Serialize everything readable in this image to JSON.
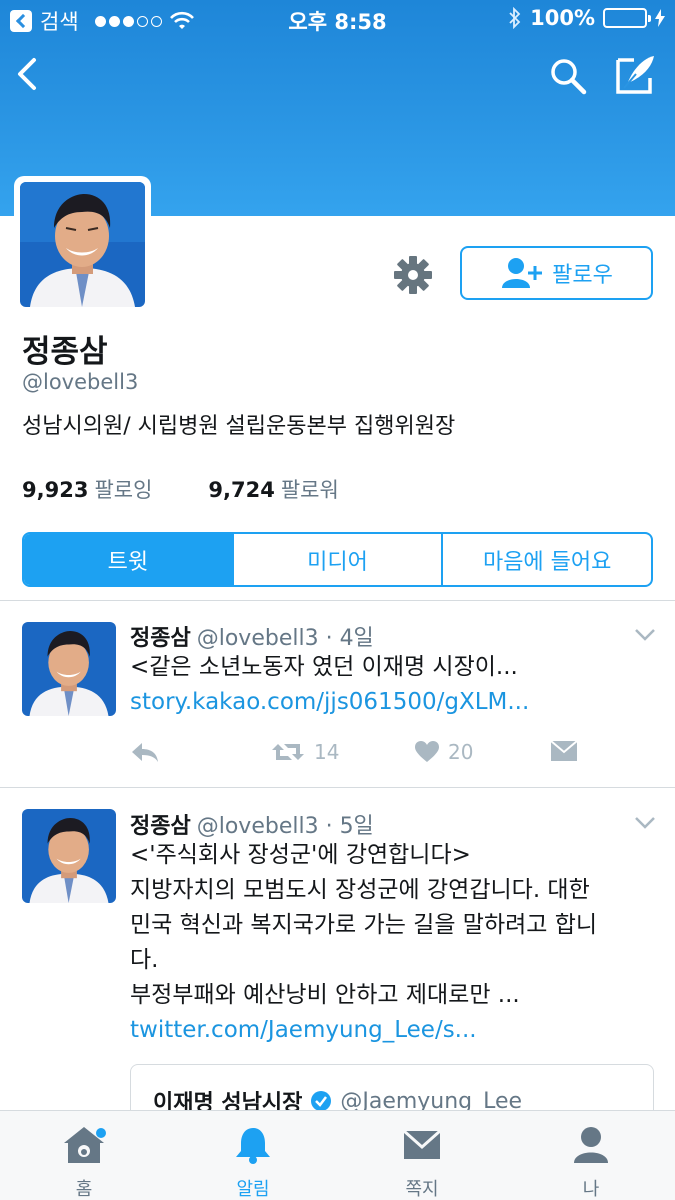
{
  "status_bar": {
    "back_app": "검색",
    "time": "오후 8:58",
    "battery": "100%"
  },
  "profile": {
    "name": "정종삼",
    "handle": "@lovebell3",
    "bio": "성남시의원/ 시립병원 설립운동본부 집행위원장",
    "following_count": "9,923",
    "following_label": "팔로잉",
    "followers_count": "9,724",
    "followers_label": "팔로워",
    "follow_label": "팔로우"
  },
  "tabs": [
    {
      "label": "트윗",
      "active": true
    },
    {
      "label": "미디어",
      "active": false
    },
    {
      "label": "마음에 들어요",
      "active": false
    }
  ],
  "tweets": [
    {
      "name": "정종삼",
      "meta": "@lovebell3 · 4일",
      "text": "<같은 소년노동자 였던 이재명 시장이...",
      "link": "story.kakao.com/jjs061500/gXLM...",
      "retweets": "14",
      "likes": "20"
    },
    {
      "name": "정종삼",
      "meta": "@lovebell3 · 5일",
      "lines": [
        "<'주식회사 장성군'에 강연합니다>",
        "지방자치의 모범도시 장성군에 강연갑니다. 대한",
        "민국 혁신과 복지국가로 가는 길을 말하려고 합니",
        "다.",
        "부정부패와 예산낭비 안하고 제대로만 ..."
      ],
      "link": "twitter.com/Jaemyung_Lee/s...",
      "quote": {
        "name": "이재명 성남시장",
        "handle": "@Jaemyung_Lee"
      }
    }
  ],
  "bottom_nav": [
    {
      "label": "홈",
      "icon": "home-icon",
      "active": false
    },
    {
      "label": "알림",
      "icon": "bell-icon",
      "active": true
    },
    {
      "label": "쪽지",
      "icon": "envelope-icon",
      "active": false
    },
    {
      "label": "나",
      "icon": "person-icon",
      "active": false
    }
  ],
  "colors": {
    "accent": "#1da1f2",
    "banner": "#2a95e3",
    "muted": "#657786",
    "link": "#1b95e0"
  }
}
